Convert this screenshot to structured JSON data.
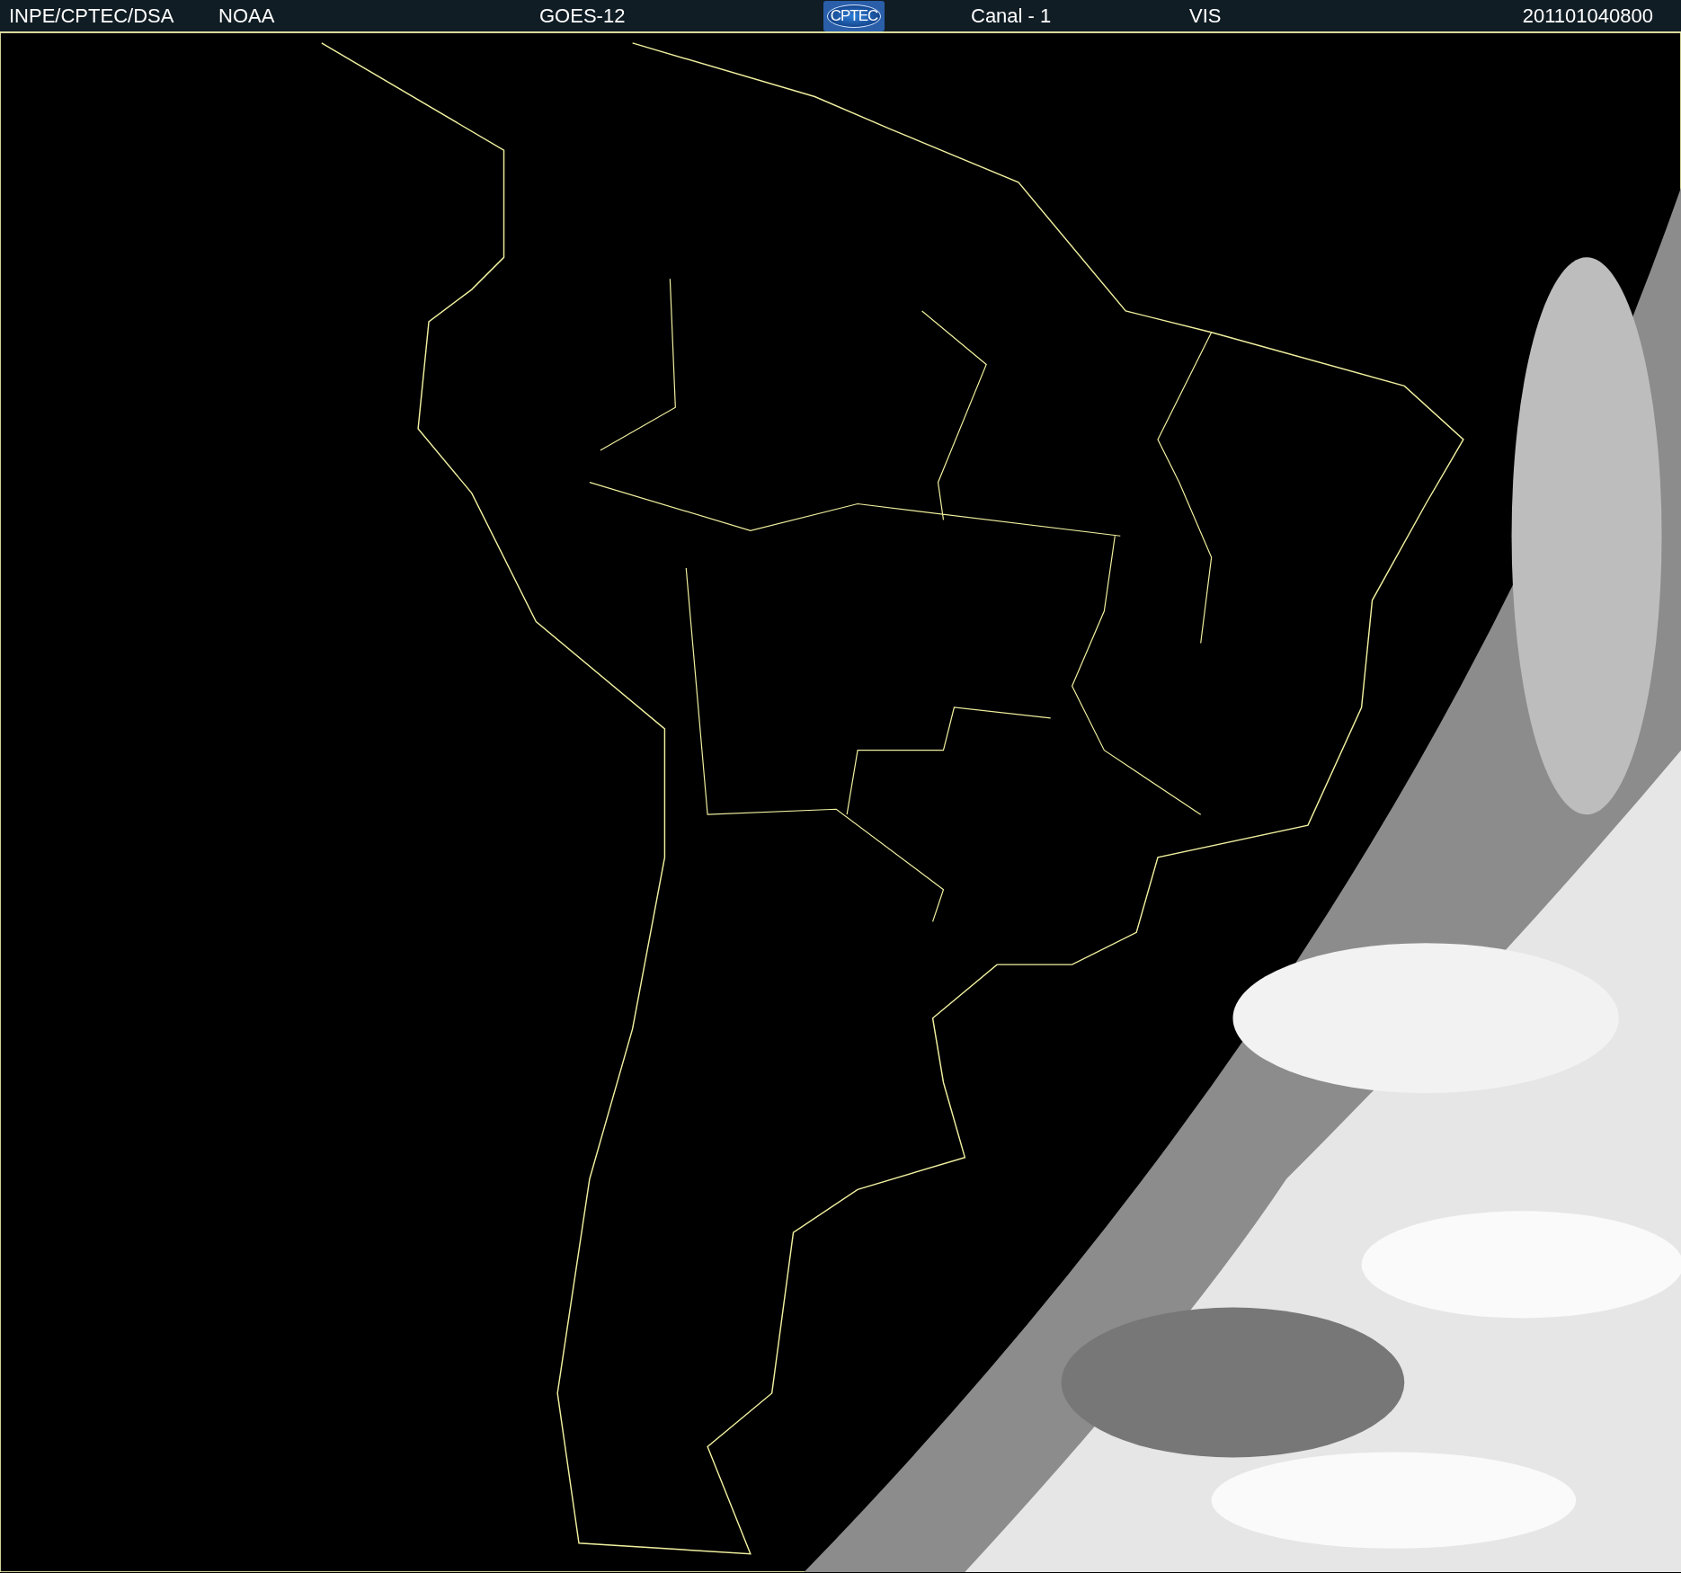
{
  "header": {
    "agency": "INPE/CPTEC/DSA",
    "partner": "NOAA",
    "satellite": "GOES-12",
    "logo": "CPTEC",
    "channel": "Canal - 1",
    "band": "VIS",
    "timestamp": "201101040800"
  }
}
